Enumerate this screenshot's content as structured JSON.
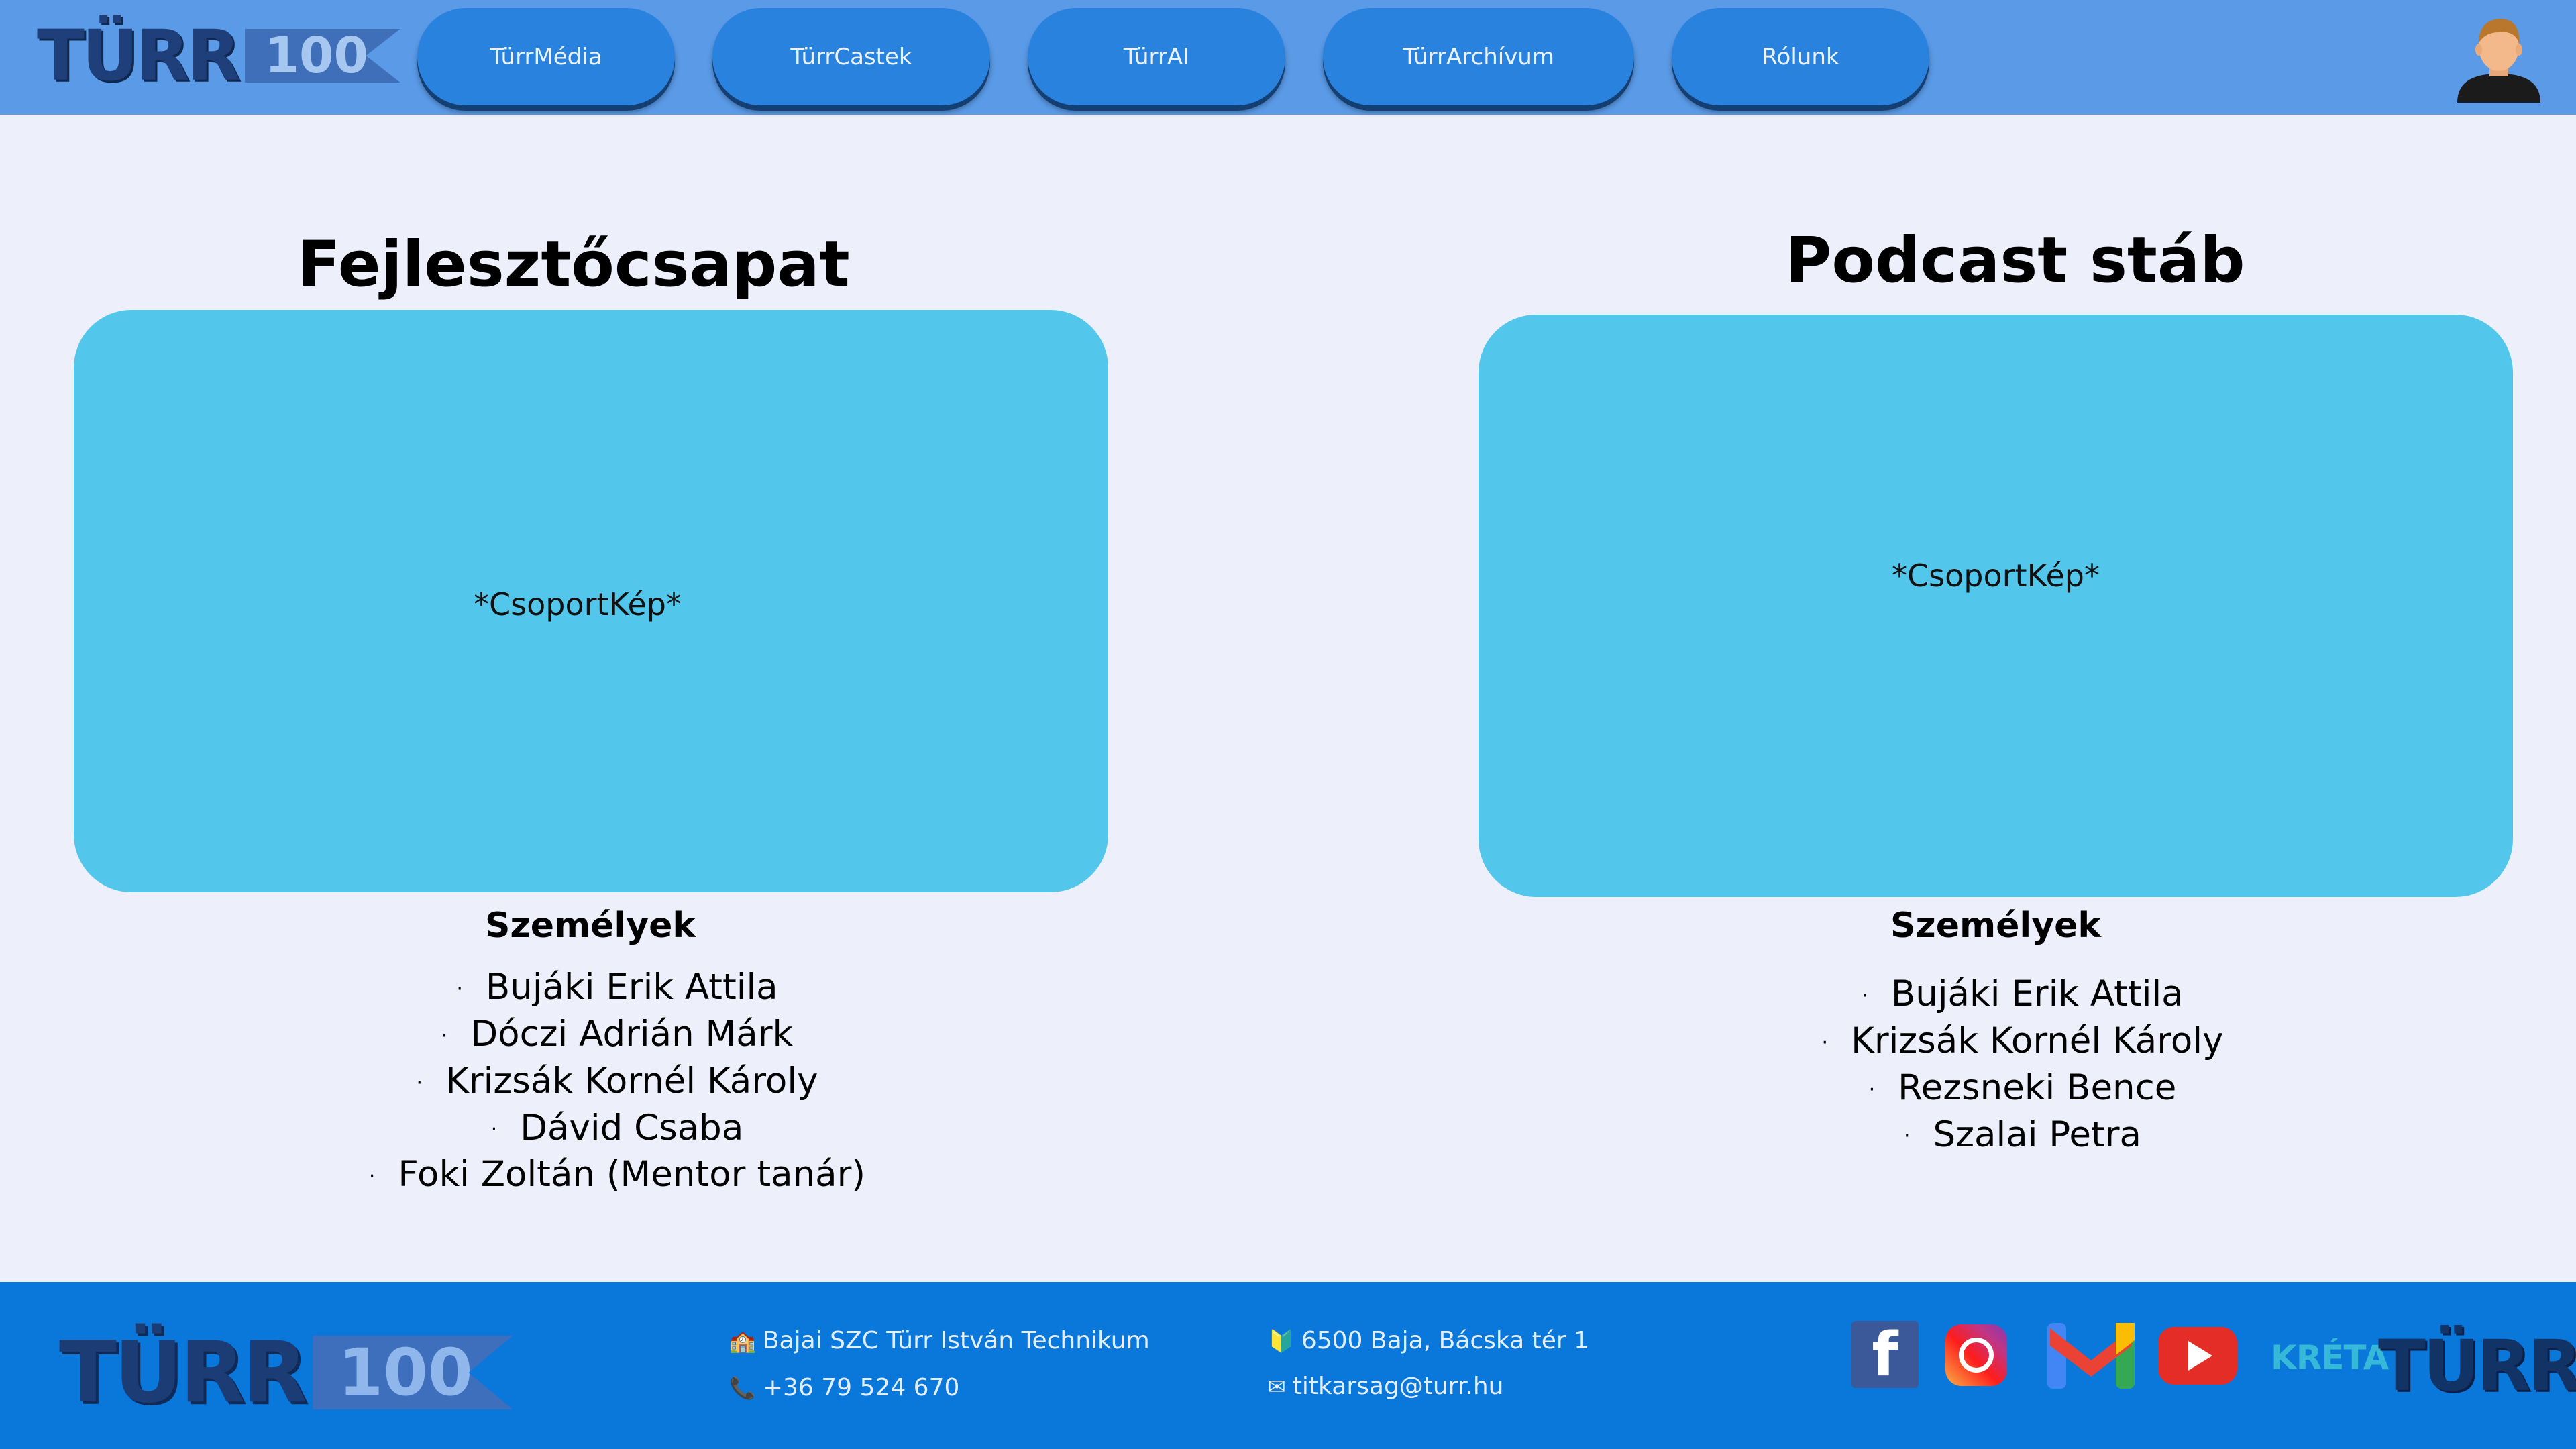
{
  "header": {
    "logo": {
      "word": "TÜRR",
      "badge": "100"
    },
    "nav": [
      {
        "label": "TürrMédia"
      },
      {
        "label": "TürrCastek"
      },
      {
        "label": "TürrAI"
      },
      {
        "label": "TürrArchívum"
      },
      {
        "label": "Rólunk"
      }
    ],
    "avatar_icon": "user-avatar-icon"
  },
  "main": {
    "left": {
      "title": "Fejlesztőcsapat",
      "photo_label": "*CsoportKép*",
      "persons_title": "Személyek",
      "persons": [
        "Bujáki Erik Attila",
        "Dóczi Adrián Márk",
        "Krizsák Kornél Károly",
        "Dávid Csaba",
        "Foki Zoltán (Mentor tanár)"
      ]
    },
    "right": {
      "title": "Podcast stáb",
      "photo_label": "*CsoportKép*",
      "persons_title": "Személyek",
      "persons": [
        "Bujáki Erik Attila",
        "Krizsák Kornél Károly",
        "Rezsneki Bence",
        "Szalai Petra"
      ]
    },
    "bullet": "·"
  },
  "footer": {
    "logo": {
      "word": "TÜRR",
      "badge": "100"
    },
    "school": "Bajai SZC Türr István Technikum",
    "phone": "+36 79 524 670",
    "address": "6500 Baja, Bácska tér 1",
    "email": "titkarsag@turr.hu",
    "social": {
      "facebook_glyph": "f",
      "kreta": "KRÉTA",
      "turr": "TÜRR"
    }
  },
  "colors": {
    "header_bg": "#5a9ae6",
    "nav_button": "#2a82df",
    "page_bg": "#edf0fb",
    "photo_box": "#53c6eb",
    "footer_bg": "#0a77db"
  }
}
